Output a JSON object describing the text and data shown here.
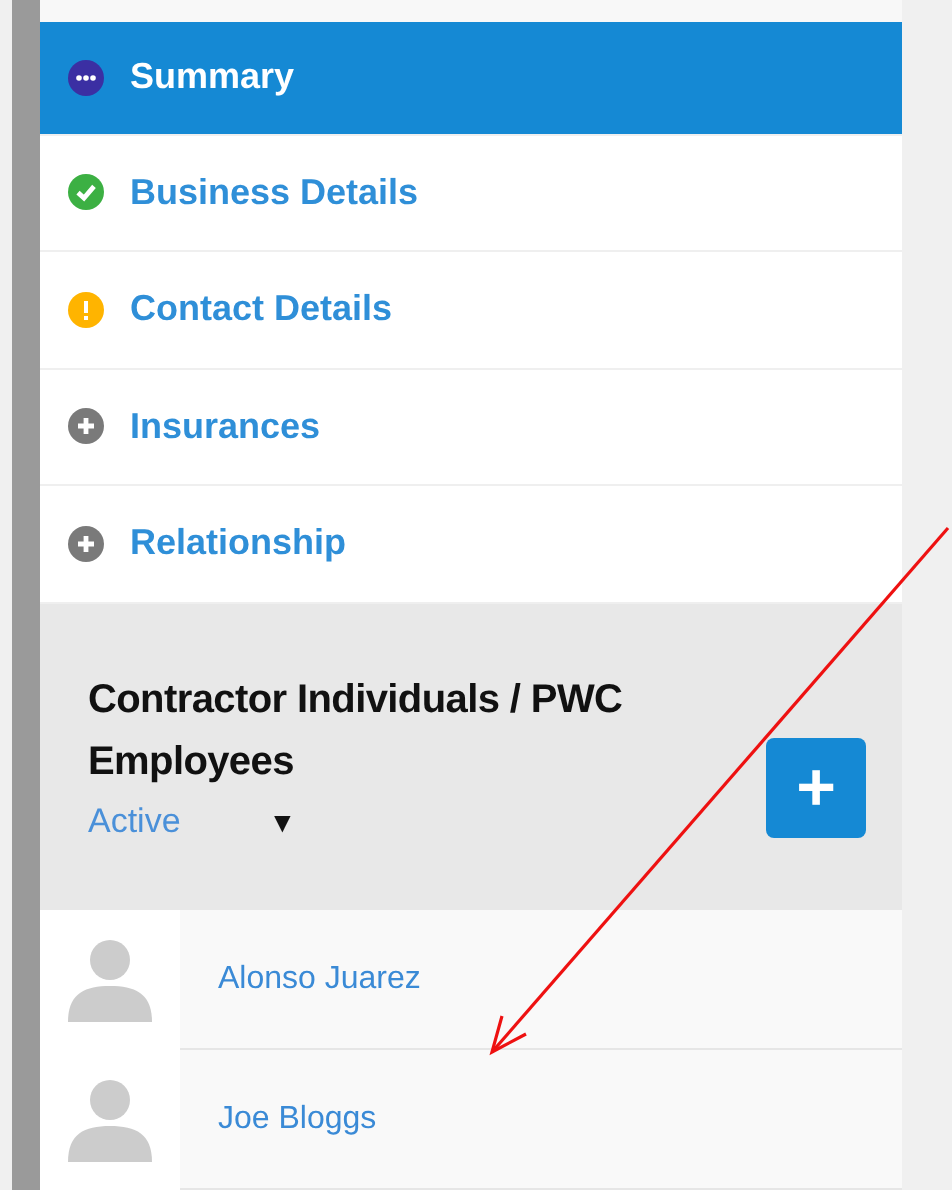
{
  "nav": [
    {
      "label": "Summary",
      "selected": true,
      "kind": "pending"
    },
    {
      "label": "Business Details",
      "selected": false,
      "kind": "complete"
    },
    {
      "label": "Contact Details",
      "selected": false,
      "kind": "warning"
    },
    {
      "label": "Insurances",
      "selected": false,
      "kind": "empty"
    },
    {
      "label": "Relationship",
      "selected": false,
      "kind": "empty"
    }
  ],
  "section": {
    "title": "Contractor Individuals / PWC Employees",
    "filter": {
      "value": "Active",
      "caret": "▼"
    },
    "add_button": "+"
  },
  "people": [
    {
      "name": "Alonso Juarez"
    },
    {
      "name": "Joe Bloggs"
    }
  ],
  "annotation": {
    "kind": "arrow"
  }
}
